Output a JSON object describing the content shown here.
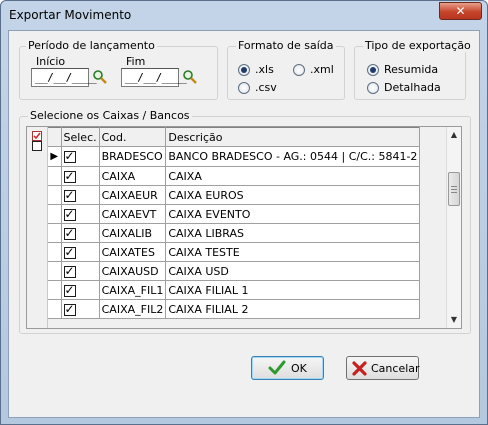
{
  "window": {
    "title": "Exportar Movimento",
    "close_glyph": "✕"
  },
  "periodo": {
    "label": "Período de lançamento",
    "inicio_label": "Início",
    "inicio_value": "__/__/____",
    "fim_label": "Fim",
    "fim_value": "__/__/____",
    "icon": "calendar-search-icon"
  },
  "formato": {
    "label": "Formato de saída",
    "options": [
      {
        "label": ".xls",
        "selected": true
      },
      {
        "label": ".xml",
        "selected": false
      },
      {
        "label": ".csv",
        "selected": false
      }
    ]
  },
  "tipo": {
    "label": "Tipo de exportação",
    "options": [
      {
        "label": "Resumida",
        "selected": true
      },
      {
        "label": "Detalhada",
        "selected": false
      }
    ]
  },
  "caixas": {
    "label": "Selecione os Caixas / Bancos",
    "columns": [
      "Selec.",
      "Cod.",
      "Descrição"
    ],
    "rows": [
      {
        "checked": true,
        "cod": "BRADESCO",
        "descricao": "BANCO BRADESCO - AG.: 0544 | C/C.: 5841-2",
        "current": true
      },
      {
        "checked": true,
        "cod": "CAIXA",
        "descricao": "CAIXA",
        "current": false
      },
      {
        "checked": true,
        "cod": "CAIXAEUR",
        "descricao": "CAIXA EUROS",
        "current": false
      },
      {
        "checked": true,
        "cod": "CAIXAEVT",
        "descricao": "CAIXA EVENTO",
        "current": false
      },
      {
        "checked": true,
        "cod": "CAIXALIB",
        "descricao": "CAIXA LIBRAS",
        "current": false
      },
      {
        "checked": true,
        "cod": "CAIXATES",
        "descricao": "CAIXA TESTE",
        "current": false
      },
      {
        "checked": true,
        "cod": "CAIXAUSD",
        "descricao": "CAIXA USD",
        "current": false
      },
      {
        "checked": true,
        "cod": "CAIXA_FIL1",
        "descricao": "CAIXA FILIAL 1",
        "current": false
      },
      {
        "checked": true,
        "cod": "CAIXA_FIL2",
        "descricao": "CAIXA FILIAL 2",
        "current": false
      }
    ]
  },
  "buttons": {
    "ok": "OK",
    "cancel": "Cancelar"
  },
  "colors": {
    "accent_green": "#2e9a2e",
    "accent_red": "#c8201e",
    "title_bar": "#b4c8e0"
  }
}
